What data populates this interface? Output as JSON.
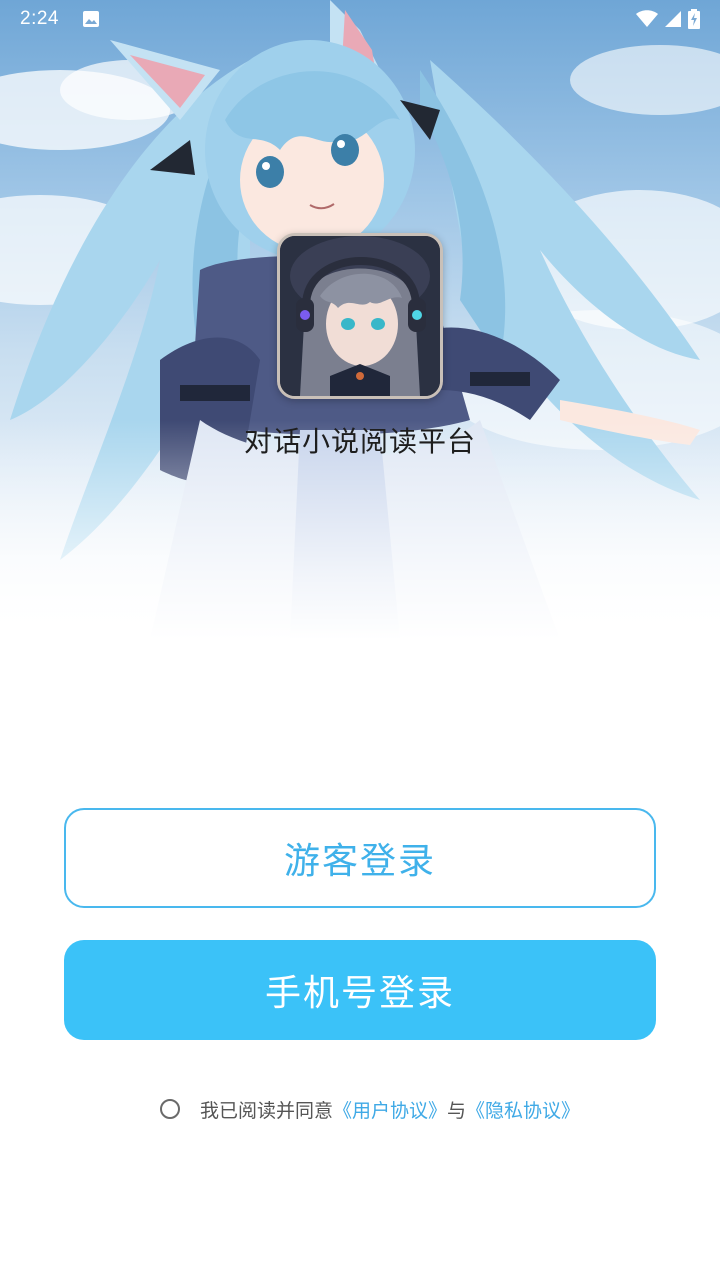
{
  "status_bar": {
    "time": "2:24",
    "left_icon": "image-icon",
    "right_icons": [
      "wifi-icon",
      "signal-icon",
      "battery-charging-icon"
    ]
  },
  "app": {
    "name": "对话小说阅读平台",
    "logo_icon": "app-logo-anime-avatar"
  },
  "buttons": {
    "guest_login": "游客登录",
    "phone_login": "手机号登录"
  },
  "agreement": {
    "prefix": "我已阅读并同意",
    "user_agreement": "《用户协议》",
    "conjunction": "与",
    "privacy_policy": "《隐私协议》"
  },
  "colors": {
    "accent": "#3bc2f8",
    "accent_border": "#49b8ee",
    "link": "#3fa9e6"
  }
}
